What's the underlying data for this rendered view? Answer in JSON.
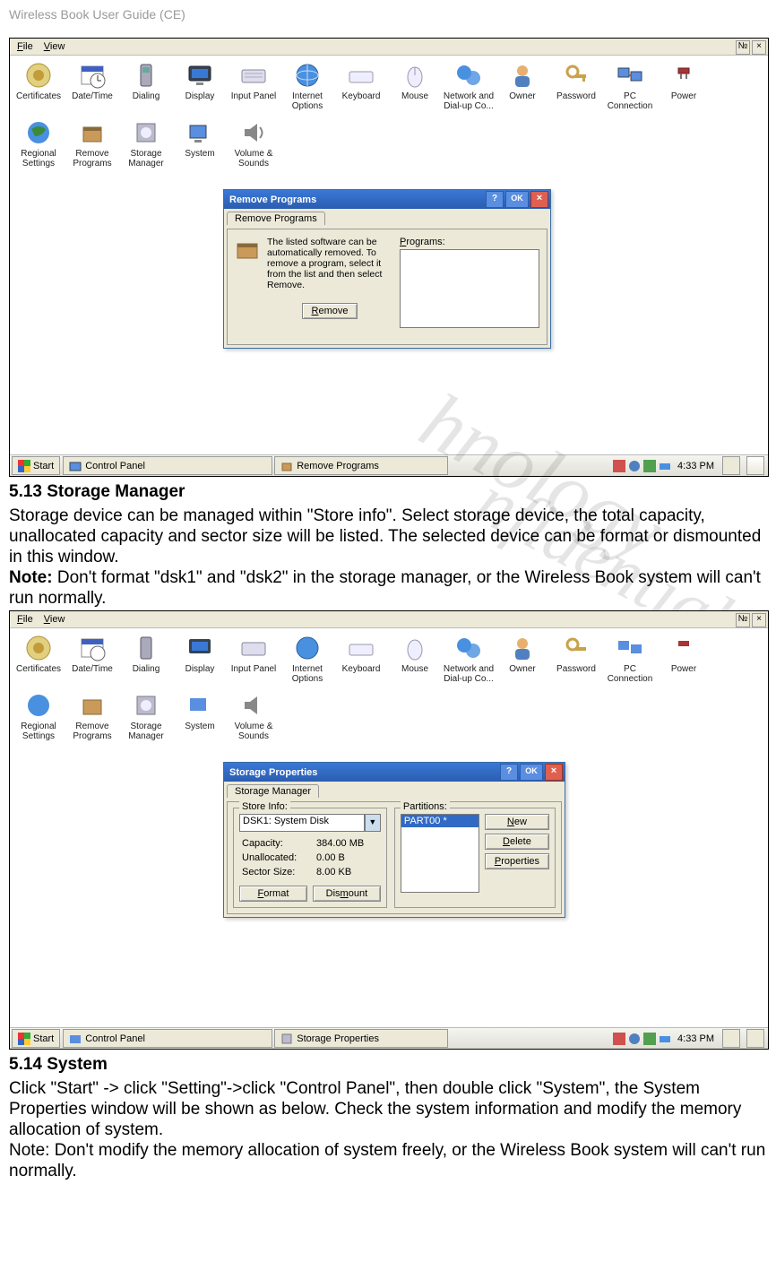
{
  "page_header": "Wireless Book User Guide (CE)",
  "menubar": {
    "file": "File",
    "view": "View",
    "help_icon": "?",
    "close_icon": "×"
  },
  "control_panel_items_row1": [
    {
      "label": "Certificates",
      "icon": "certificates-icon"
    },
    {
      "label": "Date/Time",
      "icon": "datetime-icon"
    },
    {
      "label": "Dialing",
      "icon": "dialing-icon"
    },
    {
      "label": "Display",
      "icon": "display-icon"
    },
    {
      "label": "Input Panel",
      "icon": "inputpanel-icon"
    },
    {
      "label": "Internet Options",
      "icon": "internet-icon"
    },
    {
      "label": "Keyboard",
      "icon": "keyboard-icon"
    },
    {
      "label": "Mouse",
      "icon": "mouse-icon"
    },
    {
      "label": "Network and Dial-up Co...",
      "icon": "network-icon"
    },
    {
      "label": "Owner",
      "icon": "owner-icon"
    },
    {
      "label": "Password",
      "icon": "password-icon"
    },
    {
      "label": "PC Connection",
      "icon": "pcconn-icon"
    },
    {
      "label": "Power",
      "icon": "power-icon"
    }
  ],
  "control_panel_items_row2": [
    {
      "label": "Regional Settings",
      "icon": "regional-icon"
    },
    {
      "label": "Remove Programs",
      "icon": "removeprog-icon"
    },
    {
      "label": "Storage Manager",
      "icon": "storagemgr-icon"
    },
    {
      "label": "System",
      "icon": "system-icon"
    },
    {
      "label": "Volume & Sounds",
      "icon": "volume-icon"
    }
  ],
  "remove_dialog": {
    "title": "Remove Programs",
    "tab": "Remove Programs",
    "desc": "The listed software can be automatically removed. To remove a program, select it from the list and then select Remove.",
    "programs_label": "Programs:",
    "remove_btn": "Remove"
  },
  "storage_dialog": {
    "title": "Storage Properties",
    "tab": "Storage Manager",
    "store_info_legend": "Store Info:",
    "combo_value": "DSK1: System Disk",
    "cap_label": "Capacity:",
    "cap_value": "384.00 MB",
    "unalloc_label": "Unallocated:",
    "unalloc_value": "0.00 B",
    "sector_label": "Sector Size:",
    "sector_value": "8.00 KB",
    "format_btn": "Format",
    "dismount_btn": "Dismount",
    "partitions_legend": "Partitions:",
    "partition_item": "PART00 *",
    "new_btn": "New",
    "delete_btn": "Delete",
    "props_btn": "Properties"
  },
  "taskbar": {
    "start": "Start",
    "btn_cp": "Control Panel",
    "btn_remove": "Remove Programs",
    "btn_storage": "Storage Properties",
    "clock": "4:33 PM"
  },
  "section513_head": "5.13   Storage Manager",
  "section513_body": "Storage device can be managed within \"Store info\". Select storage device, the total capacity, unallocated capacity and sector size will be listed. The selected device can be format or dismounted in this window.",
  "section513_note_label": "Note:",
  "section513_note_body": " Don't format \"dsk1\" and \"dsk2\" in the storage manager, or the Wireless Book system will can't run normally.",
  "section514_head": "5.14   System",
  "section514_body": "Click \"Start\" -> click \"Setting\"->click \"Control Panel\", then double click \"System\", the System Properties window will be shown as below. Check the system information and modify the memory allocation of system.",
  "section514_note": "Note: Don't modify the memory allocation of system freely, or the Wireless Book system will can't run normally.",
  "watermark_top": "hnology",
  "watermark_bottom": "nfidential"
}
